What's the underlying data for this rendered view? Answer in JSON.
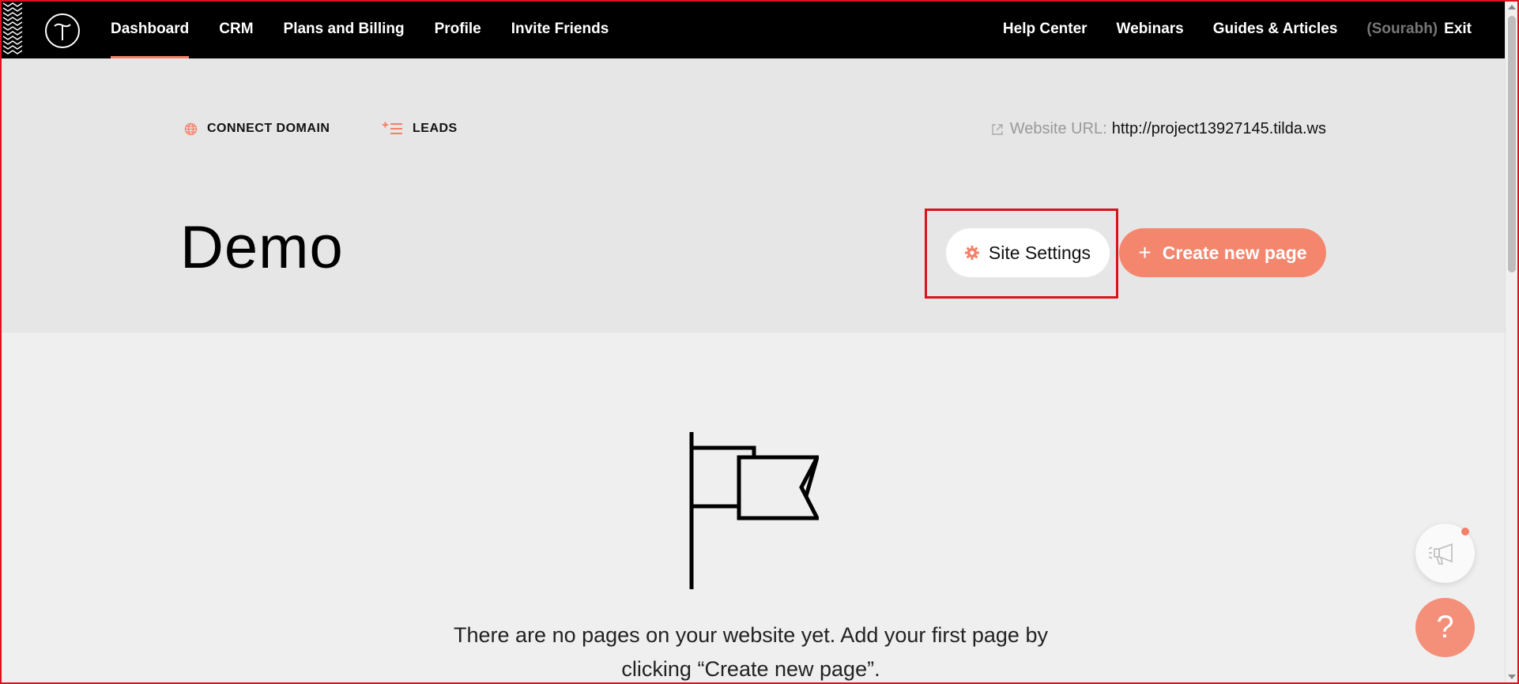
{
  "nav": {
    "left": [
      "Dashboard",
      "CRM",
      "Plans and Billing",
      "Profile",
      "Invite Friends"
    ],
    "right": [
      "Help Center",
      "Webinars",
      "Guides & Articles"
    ],
    "user": "(Sourabh)",
    "exit": "Exit",
    "active": "Dashboard"
  },
  "header": {
    "connect_domain": "CONNECT DOMAIN",
    "leads": "LEADS",
    "url_label": "Website URL:",
    "url_value": "http://project13927145.tilda.ws",
    "title": "Demo",
    "site_settings": "Site Settings",
    "create_page": "Create new page",
    "create_plus": "+"
  },
  "empty": {
    "message": "There are no pages on your website yet. Add your first page by clicking “Create new page”."
  },
  "help": {
    "label": "?"
  },
  "colors": {
    "accent": "#f4806a",
    "highlight": "#d8141c",
    "nav_bg": "#000000"
  }
}
